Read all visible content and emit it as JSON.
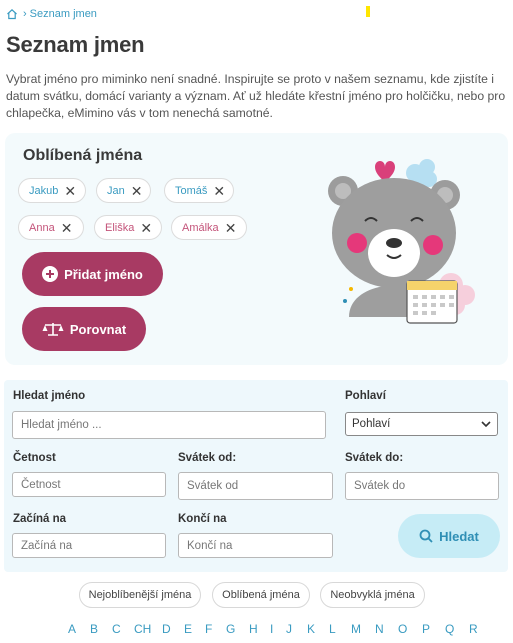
{
  "breadcrumb": {
    "home_icon": "home-icon",
    "separator": "›",
    "current": "Seznam jmen"
  },
  "page": {
    "title": "Seznam jmen",
    "intro": "Vybrat jméno pro miminko není snadné. Inspirujte se proto v našem seznamu, kde zjistíte i datum svátku, domácí varianty a význam. Ať už hledáte křestní jméno pro holčičku, nebo pro chlapečka, eMimino vás v tom nenechá samotné."
  },
  "favorites": {
    "title": "Oblíbená jména",
    "chips": [
      {
        "label": "Jakub",
        "gender": "boy"
      },
      {
        "label": "Jan",
        "gender": "boy"
      },
      {
        "label": "Tomáš",
        "gender": "boy"
      },
      {
        "label": "Anna",
        "gender": "girl"
      },
      {
        "label": "Eliška",
        "gender": "girl"
      },
      {
        "label": "Amálka",
        "gender": "girl"
      }
    ],
    "remove_glyph": "✕",
    "add_button": "Přidat jméno",
    "compare_button": "Porovnat",
    "colors": {
      "boy": "#3a9bc1",
      "girl": "#c4547a",
      "button": "#a83a63"
    }
  },
  "search": {
    "name_label": "Hledat jméno",
    "name_placeholder": "Hledat jméno ...",
    "gender_label": "Pohlaví",
    "gender_selected": "Pohlaví",
    "frequency_label": "Četnost",
    "frequency_placeholder": "Četnost",
    "feast_from_label": "Svátek od:",
    "feast_from_placeholder": "Svátek od",
    "feast_to_label": "Svátek do:",
    "feast_to_placeholder": "Svátek do",
    "starts_label": "Začíná na",
    "starts_placeholder": "Začíná na",
    "ends_label": "Končí na",
    "ends_placeholder": "Končí na",
    "submit": "Hledat"
  },
  "filters": [
    "Nejoblíbenější jména",
    "Oblíbená jména",
    "Neobvyklá jména"
  ],
  "alphabet": [
    "A",
    "B",
    "C",
    "CH",
    "D",
    "E",
    "F",
    "G",
    "H",
    "I",
    "J",
    "K",
    "L",
    "M",
    "N",
    "O",
    "P",
    "Q",
    "R"
  ]
}
